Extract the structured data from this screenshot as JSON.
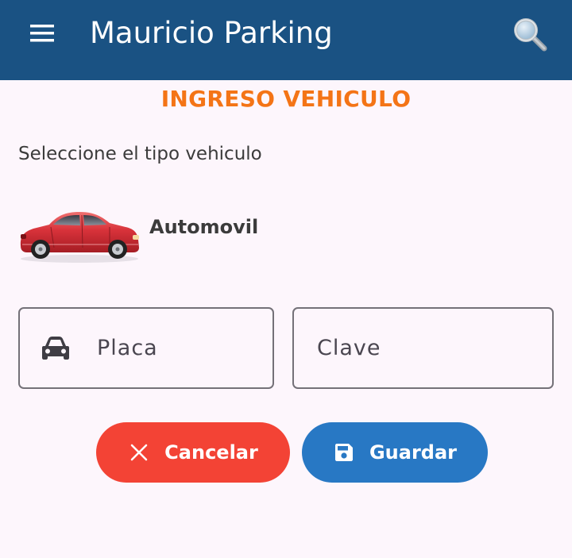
{
  "app_bar": {
    "title": "Mauricio Parking",
    "menu_icon": "menu-icon",
    "search_icon": "search-icon"
  },
  "page": {
    "heading": "INGRESO VEHICULO",
    "prompt": "Seleccione el tipo vehiculo"
  },
  "vehicle": {
    "label": "Automovil",
    "image": "red-car-image"
  },
  "fields": {
    "placa": {
      "placeholder": "Placa",
      "icon": "car-icon"
    },
    "clave": {
      "placeholder": "Clave"
    }
  },
  "actions": {
    "cancel_label": "Cancelar",
    "cancel_icon": "close-icon",
    "save_label": "Guardar",
    "save_icon": "save-icon"
  },
  "colors": {
    "app_bar": "#1a5283",
    "heading": "#f47416",
    "cancel": "#f34335",
    "save": "#2878c4",
    "background": "#fdf6fc"
  }
}
